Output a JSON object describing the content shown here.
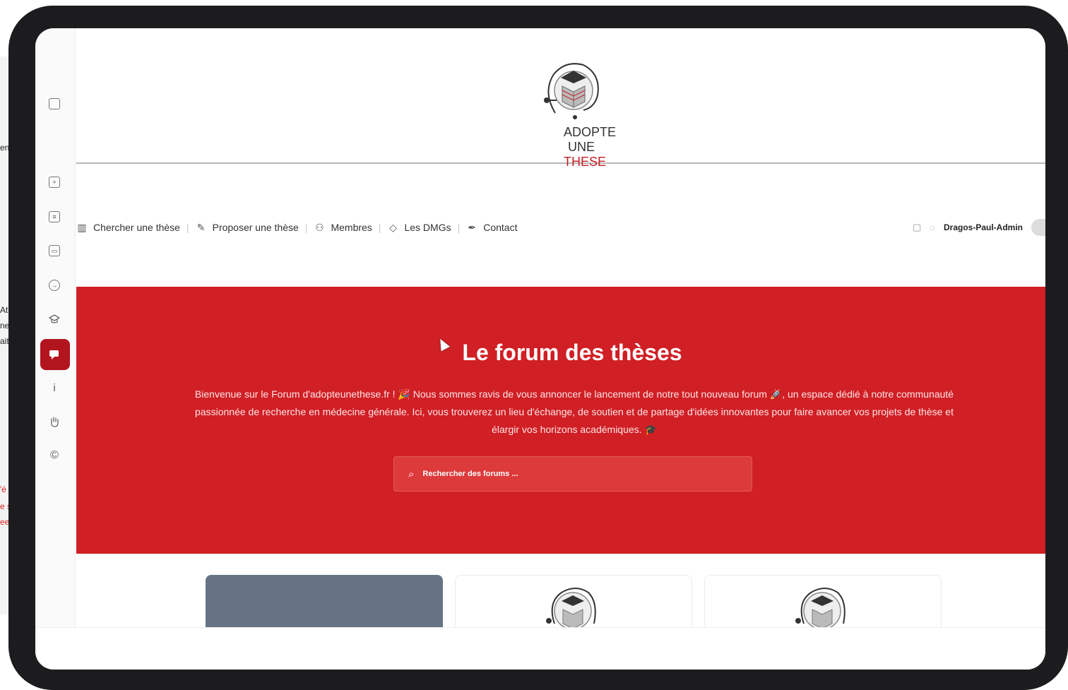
{
  "background_window": {
    "snippets": [
      "en",
      "At",
      "ne",
      "ait",
      "'é",
      "e s",
      "ee"
    ]
  },
  "rail": {
    "icons": [
      "sidebar-toggle-icon",
      "activity-icon",
      "document-icon",
      "calendar-edit-icon",
      "login-icon",
      "graduation-cap-icon",
      "chat-icon",
      "info-icon",
      "hand-icon",
      "copyright-icon"
    ],
    "info_glyph": "i",
    "copyright_glyph": "©"
  },
  "logo": {
    "line1": "ADOPTE",
    "line2_a": "UNE ",
    "line2_b": "THESE"
  },
  "nav": {
    "items": [
      {
        "label": "Chercher une thèse",
        "icon": "books-icon"
      },
      {
        "label": "Proposer une thèse",
        "icon": "pen-icon"
      },
      {
        "label": "Membres",
        "icon": "users-icon"
      },
      {
        "label": "Les DMGs",
        "icon": "graduation-cap-icon"
      },
      {
        "label": "Contact",
        "icon": "quill-icon"
      }
    ],
    "separator": "|",
    "user_name": "Dragos-Paul-Admin"
  },
  "hero": {
    "title": "Le forum des thèses",
    "description": "Bienvenue sur le Forum d'adopteunethese.fr ! 🎉 Nous sommes ravis de vous annoncer le lancement de notre tout nouveau forum 🚀, un espace dédié à notre communauté passionnée de recherche en médecine générale. Ici, vous trouverez un lieu d'échange, de soutien et de partage d'idées innovantes pour faire avancer vos projets de thèse et élargir vos horizons académiques. 🎓",
    "search_placeholder": "Rechercher des forums ..."
  },
  "colors": {
    "brand_red": "#d01f25",
    "rail_active": "#b3151f",
    "card_gray": "#667385"
  }
}
